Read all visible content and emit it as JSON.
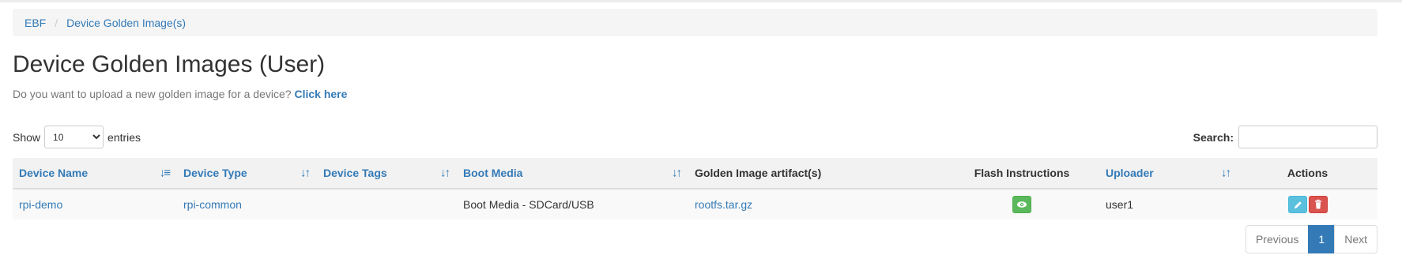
{
  "breadcrumb": {
    "items": [
      "EBF",
      "Device Golden Image(s)"
    ]
  },
  "page_title": "Device Golden Images (User)",
  "intro": {
    "text": "Do you want to upload a new golden image for a device?",
    "link": "Click here"
  },
  "length_control": {
    "prefix": "Show",
    "selected": "10",
    "suffix": "entries"
  },
  "search": {
    "label": "Search:",
    "value": ""
  },
  "table": {
    "columns": [
      "Device Name",
      "Device Type",
      "Device Tags",
      "Boot Media",
      "Golden Image artifact(s)",
      "Flash Instructions",
      "Uploader",
      "Actions"
    ],
    "rows": [
      {
        "device_name": "rpi-demo",
        "device_type": "rpi-common",
        "device_tags": "",
        "boot_media": "Boot Media - SDCard/USB",
        "artifact": "rootfs.tar.gz",
        "uploader": "user1"
      }
    ]
  },
  "pagination": {
    "previous": "Previous",
    "current": "1",
    "next": "Next"
  },
  "icons": {
    "flash": "eye-icon",
    "edit": "pencil-icon",
    "delete": "trash-icon",
    "sort": "sort-arrows-icon"
  },
  "colors": {
    "link": "#337ab7",
    "success": "#5cb85c",
    "info": "#5bc0de",
    "danger": "#d9534f"
  }
}
